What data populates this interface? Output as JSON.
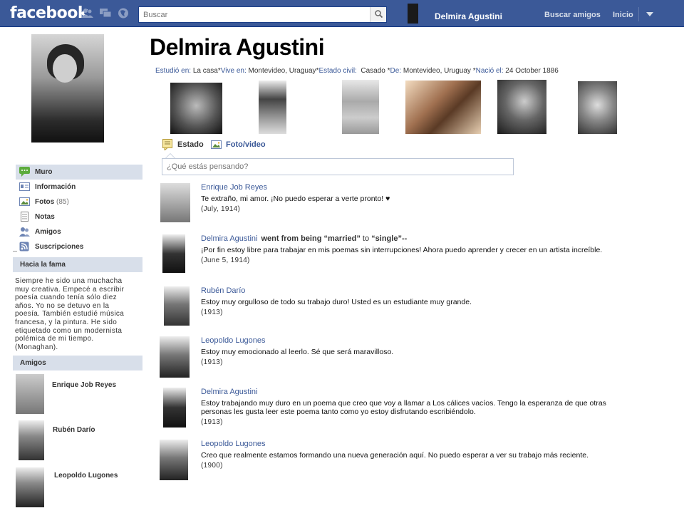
{
  "topbar": {
    "logo": "facebook",
    "search_placeholder": "Buscar",
    "user_name": "Delmira Agustini",
    "find_friends": "Buscar amigos",
    "home": "Inicio",
    "brand_color": "#3b5998"
  },
  "profile": {
    "name": "Delmira Agustini",
    "info": [
      {
        "key": "Estudió en:",
        "value": "La casa"
      },
      {
        "key": "Vive en:",
        "value": "Montevideo, Uraguay"
      },
      {
        "key": "Estado civil:",
        "value": "Casado"
      },
      {
        "key": "De:",
        "value": "Montevideo, Uruguay"
      },
      {
        "key": "Nació el:",
        "value": "24 October 1886"
      }
    ]
  },
  "nav": [
    {
      "label": "Muro",
      "icon": "wall-icon",
      "active": true
    },
    {
      "label": "Información",
      "icon": "info-icon"
    },
    {
      "label": "Fotos",
      "count": "(85)",
      "icon": "photos-icon"
    },
    {
      "label": "Notas",
      "icon": "notes-icon"
    },
    {
      "label": "Amigos",
      "icon": "friends-icon"
    },
    {
      "label": "Suscripciones",
      "icon": "subscriptions-icon"
    }
  ],
  "fame": {
    "heading": "Hacia la fama",
    "lines": [
      "Siempre he sido una muchacha",
      "muy creativa. Empecé a escribir",
      "poesía cuando tenía sólo diez",
      "años. Yo no se detuvo en la",
      "poesía. También estudié música",
      "francesa, y la pintura. He sido",
      "etiquetado como un modernista",
      "polémica de mi tiempo.",
      "(Monaghan)."
    ]
  },
  "friends": {
    "heading": "Amigos",
    "items": [
      "Enrique Job Reyes",
      "Rubén Darío",
      "Leopoldo Lugones"
    ]
  },
  "composer": {
    "status_tab": "Estado",
    "photo_tab": "Foto/video",
    "placeholder": "¿Qué estás pensando?"
  },
  "posts": [
    {
      "author": "Enrique Job Reyes",
      "text": "Te extraño, mi amor. ¡No puedo esperar a verte pronto! ♥",
      "date": "(July, 1914)"
    },
    {
      "author": "Delmira Agustini",
      "extra_a": "went from being “married”",
      "extra_b": "to",
      "extra_c": "“single”--",
      "text": "¡Por fin estoy libre para trabajar en mis poemas sin interrupciones! Ahora puedo aprender y crecer en un artista increíble.",
      "date": "(June 5, 1914)"
    },
    {
      "author": "Rubén Darío",
      "text": "Estoy muy orgulloso de todo su trabajo duro! Usted es un estudiante muy grande.",
      "date": "(1913)"
    },
    {
      "author": "Leopoldo Lugones",
      "text": "Estoy muy emocionado al leerlo. Sé que será maravilloso.",
      "date": "(1913)"
    },
    {
      "author": "Delmira Agustini",
      "text": "Estoy trabajando muy duro en un poema que creo que voy a llamar a Los cálices vacíos. Tengo la esperanza de que otras personas les gusta leer este poema tanto como yo estoy disfrutando escribiéndolo.",
      "date": "(1913)"
    },
    {
      "author": "Leopoldo Lugones",
      "text": "Creo que realmente estamos formando una nueva generación aquí. No puedo esperar a ver su trabajo más reciente.",
      "date": "(1900)"
    }
  ]
}
